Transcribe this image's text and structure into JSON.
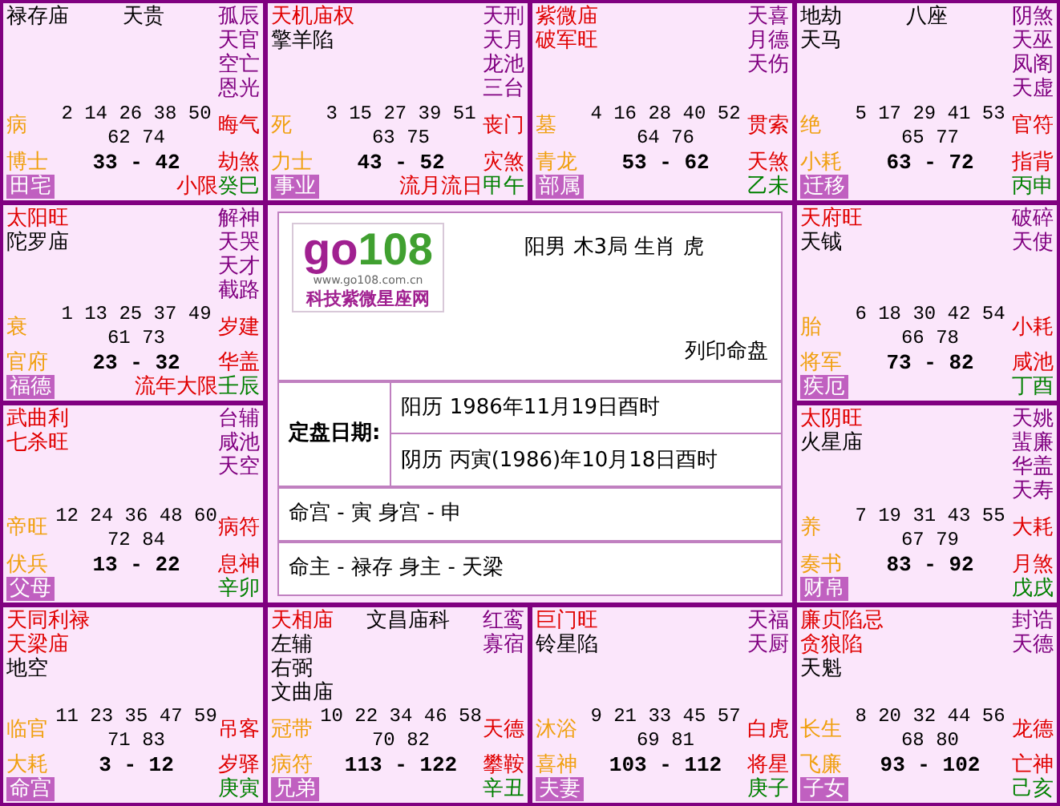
{
  "cells": [
    {
      "stars": [
        {
          "text": "禄存庙",
          "kind": "aux"
        }
      ],
      "extra": "天贵",
      "minor": [
        "孤辰",
        "天官",
        "空亡",
        "恩光"
      ],
      "stage": "病",
      "years": [
        "2 14 26 38 50",
        "62 74"
      ],
      "god_1": "晦气",
      "doctor": "博士",
      "range": "33 - 42",
      "god_2": "劫煞",
      "palace": "田宅",
      "flag": "小限",
      "ganzhi": "癸巳"
    },
    {
      "stars": [
        {
          "text": "天机庙权",
          "kind": "major"
        },
        {
          "text": "擎羊陷",
          "kind": "aux"
        }
      ],
      "minor": [
        "天刑",
        "天月",
        "龙池",
        "三台"
      ],
      "stage": "死",
      "years": [
        "3 15 27 39 51",
        "63 75"
      ],
      "god_1": "丧门",
      "doctor": "力士",
      "range": "43 - 52",
      "god_2": "灾煞",
      "palace": "事业",
      "flag": "流月流日",
      "ganzhi": "甲午"
    },
    {
      "stars": [
        {
          "text": "紫微庙",
          "kind": "major"
        },
        {
          "text": "破军旺",
          "kind": "major"
        }
      ],
      "minor": [
        "天喜",
        "月德",
        "天伤"
      ],
      "stage": "墓",
      "years": [
        "4 16 28 40 52",
        "64 76"
      ],
      "god_1": "贯索",
      "doctor": "青龙",
      "range": "53 - 62",
      "god_2": "天煞",
      "palace": "部属",
      "ganzhi": "乙未"
    },
    {
      "stars": [
        {
          "text": "地劫",
          "kind": "aux"
        },
        {
          "text": "天马",
          "kind": "aux"
        }
      ],
      "extra": "八座",
      "minor": [
        "阴煞",
        "天巫",
        "凤阁",
        "天虚"
      ],
      "stage": "绝",
      "years": [
        "5 17 29 41 53",
        "65 77"
      ],
      "god_1": "官符",
      "doctor": "小耗",
      "range": "63 - 72",
      "god_2": "指背",
      "palace": "迁移",
      "ganzhi": "丙申"
    },
    {
      "stars": [
        {
          "text": "太阳旺",
          "kind": "major"
        },
        {
          "text": "陀罗庙",
          "kind": "aux"
        }
      ],
      "minor": [
        "解神",
        "天哭",
        "天才",
        "截路"
      ],
      "stage": "衰",
      "years": [
        "1 13 25 37 49",
        "61 73"
      ],
      "god_1": "岁建",
      "doctor": "官府",
      "range": "23 - 32",
      "god_2": "华盖",
      "palace": "福德",
      "flag": "流年大限",
      "ganzhi": "壬辰"
    },
    {
      "stars": [
        {
          "text": "天府旺",
          "kind": "major"
        },
        {
          "text": "天钺",
          "kind": "aux"
        }
      ],
      "minor": [
        "破碎",
        "天使"
      ],
      "stage": "胎",
      "years": [
        "6 18 30 42 54",
        "66 78"
      ],
      "god_1": "小耗",
      "doctor": "将军",
      "range": "73 - 82",
      "god_2": "咸池",
      "palace": "疾厄",
      "ganzhi": "丁酉"
    },
    {
      "stars": [
        {
          "text": "武曲利",
          "kind": "major"
        },
        {
          "text": "七杀旺",
          "kind": "major"
        }
      ],
      "minor": [
        "台辅",
        "咸池",
        "天空"
      ],
      "stage": "帝旺",
      "years": [
        "12 24 36 48 60",
        "72 84"
      ],
      "god_1": "病符",
      "doctor": "伏兵",
      "range": "13 - 22",
      "god_2": "息神",
      "palace": "父母",
      "ganzhi": "辛卯"
    },
    {
      "stars": [
        {
          "text": "太阴旺",
          "kind": "major"
        },
        {
          "text": "火星庙",
          "kind": "aux"
        }
      ],
      "minor": [
        "天姚",
        "蜚廉",
        "华盖",
        "天寿"
      ],
      "stage": "养",
      "years": [
        "7 19 31 43 55",
        "67 79"
      ],
      "god_1": "大耗",
      "doctor": "奏书",
      "range": "83 - 92",
      "god_2": "月煞",
      "palace": "财帛",
      "ganzhi": "戊戌"
    },
    {
      "stars": [
        {
          "text": "天同利禄",
          "kind": "major"
        },
        {
          "text": "天梁庙",
          "kind": "major"
        },
        {
          "text": "地空",
          "kind": "aux"
        }
      ],
      "stage": "临官",
      "years": [
        "11 23 35 47 59",
        "71 83"
      ],
      "god_1": "吊客",
      "doctor": "大耗",
      "range": "3 - 12",
      "god_2": "岁驿",
      "palace": "命宫",
      "ganzhi": "庚寅"
    },
    {
      "stars": [
        {
          "text": "天相庙",
          "kind": "major"
        },
        {
          "text": "左辅",
          "kind": "aux"
        },
        {
          "text": "右弼",
          "kind": "aux"
        },
        {
          "text": "文曲庙",
          "kind": "aux"
        }
      ],
      "extra": "文昌庙科",
      "minor": [
        "红鸾",
        "寡宿"
      ],
      "stage": "冠带",
      "years": [
        "10 22 34 46 58",
        "70 82"
      ],
      "god_1": "天德",
      "doctor": "病符",
      "range": "113 - 122",
      "god_2": "攀鞍",
      "palace": "兄弟",
      "ganzhi": "辛丑"
    },
    {
      "stars": [
        {
          "text": "巨门旺",
          "kind": "major"
        },
        {
          "text": "铃星陷",
          "kind": "aux"
        }
      ],
      "minor": [
        "天福",
        "天厨"
      ],
      "stage": "沐浴",
      "years": [
        "9 21 33 45 57",
        "69 81"
      ],
      "god_1": "白虎",
      "doctor": "喜神",
      "range": "103 - 112",
      "god_2": "将星",
      "palace": "夫妻",
      "ganzhi": "庚子"
    },
    {
      "stars": [
        {
          "text": "廉贞陷忌",
          "kind": "major"
        },
        {
          "text": "贪狼陷",
          "kind": "major"
        },
        {
          "text": "天魁",
          "kind": "aux"
        }
      ],
      "minor": [
        "封诰",
        "天德"
      ],
      "stage": "长生",
      "years": [
        "8 20 32 44 56",
        "68 80"
      ],
      "god_1": "龙德",
      "doctor": "飞廉",
      "range": "93 - 102",
      "god_2": "亡神",
      "palace": "子女",
      "ganzhi": "己亥"
    }
  ],
  "center": {
    "logo_1": "go",
    "logo_2": "108",
    "logo_url": "www.go108.com.cn",
    "logo_sub": "科技紫微星座网",
    "summary": "阳男 木3局 生肖 虎",
    "print_link": "列印命盘",
    "date_label": "定盘日期:",
    "solar": "阳历 1986年11月19日酉时",
    "lunar": "阴历 丙寅(1986)年10月18日酉时",
    "palace_line": "命宫 - 寅   身宫 - 申",
    "master_line": "命主 - 禄存   身主 - 天梁"
  }
}
